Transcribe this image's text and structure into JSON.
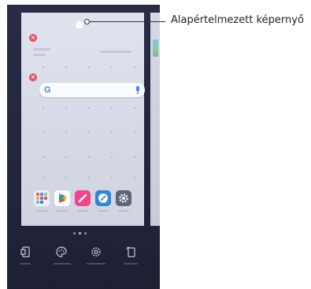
{
  "callout": {
    "label": "Alapértelmezett képernyő"
  },
  "home_screen": {
    "search_bar": {
      "logo": "G",
      "logo_icon": "google-g-icon",
      "mic_icon": "microphone-icon"
    },
    "remove_badge": "×",
    "apps": [
      {
        "icon": "app-folder-icon",
        "color": "#e86a5a"
      },
      {
        "icon": "play-store-icon",
        "color": "#ffffff"
      },
      {
        "icon": "pen-app-icon",
        "color": "#f0458a"
      },
      {
        "icon": "compass-app-icon",
        "color": "#2f86d8"
      },
      {
        "icon": "settings-gear-icon",
        "color": "#5f6477"
      }
    ]
  },
  "bottom_toolbar": {
    "items": [
      {
        "icon": "wallpaper-phone-icon"
      },
      {
        "icon": "theme-palette-icon"
      },
      {
        "icon": "settings-gear-icon"
      },
      {
        "icon": "rotate-screen-icon"
      }
    ]
  }
}
